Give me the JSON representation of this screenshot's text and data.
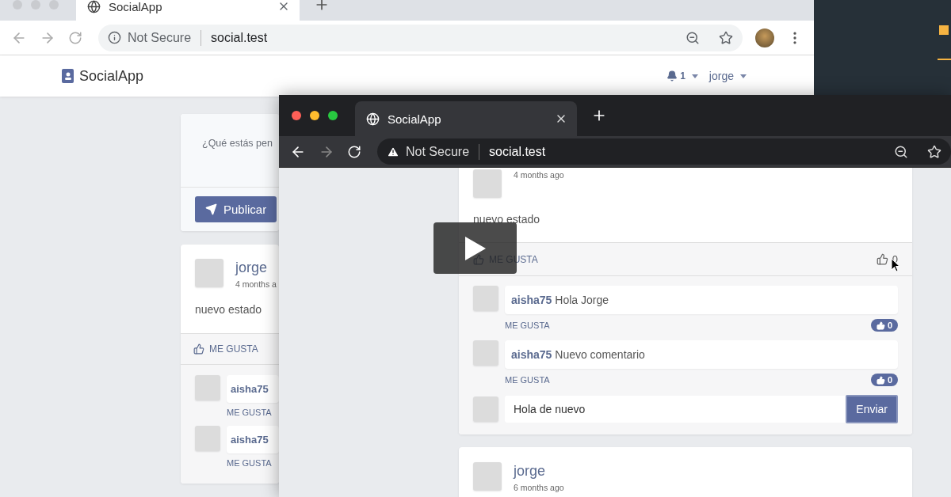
{
  "back_window": {
    "tab": {
      "title": "SocialApp"
    },
    "address": {
      "security": "Not Secure",
      "url": "social.test"
    },
    "navbar": {
      "brand": "SocialApp",
      "notifications": "1",
      "user": "jorge"
    },
    "composer": {
      "placeholder": "¿Qué estás pen",
      "button": "Publicar"
    },
    "status": {
      "author": "jorge",
      "time": "4 months a",
      "body": "nuevo estado",
      "like_label": "ME GUSTA",
      "comments": [
        {
          "author": "aisha75",
          "like_label": "ME GUSTA"
        },
        {
          "author": "aisha75",
          "like_label": "ME GUSTA"
        }
      ]
    }
  },
  "front_window": {
    "tab": {
      "title": "SocialApp"
    },
    "address": {
      "security": "Not Secure",
      "url": "social.test"
    },
    "statuses": [
      {
        "time": "4 months ago",
        "body": "nuevo estado",
        "like_label": "ME GUSTA",
        "like_count": "0",
        "comments": [
          {
            "author": "aisha75",
            "text": "Hola Jorge",
            "like_label": "ME GUSTA",
            "like_count": "0"
          },
          {
            "author": "aisha75",
            "text": "Nuevo comentario",
            "like_label": "ME GUSTA",
            "like_count": "0"
          }
        ],
        "reply": {
          "value": "Hola de nuevo",
          "button": "Enviar"
        }
      },
      {
        "author": "jorge",
        "time": "6 months ago"
      }
    ]
  }
}
